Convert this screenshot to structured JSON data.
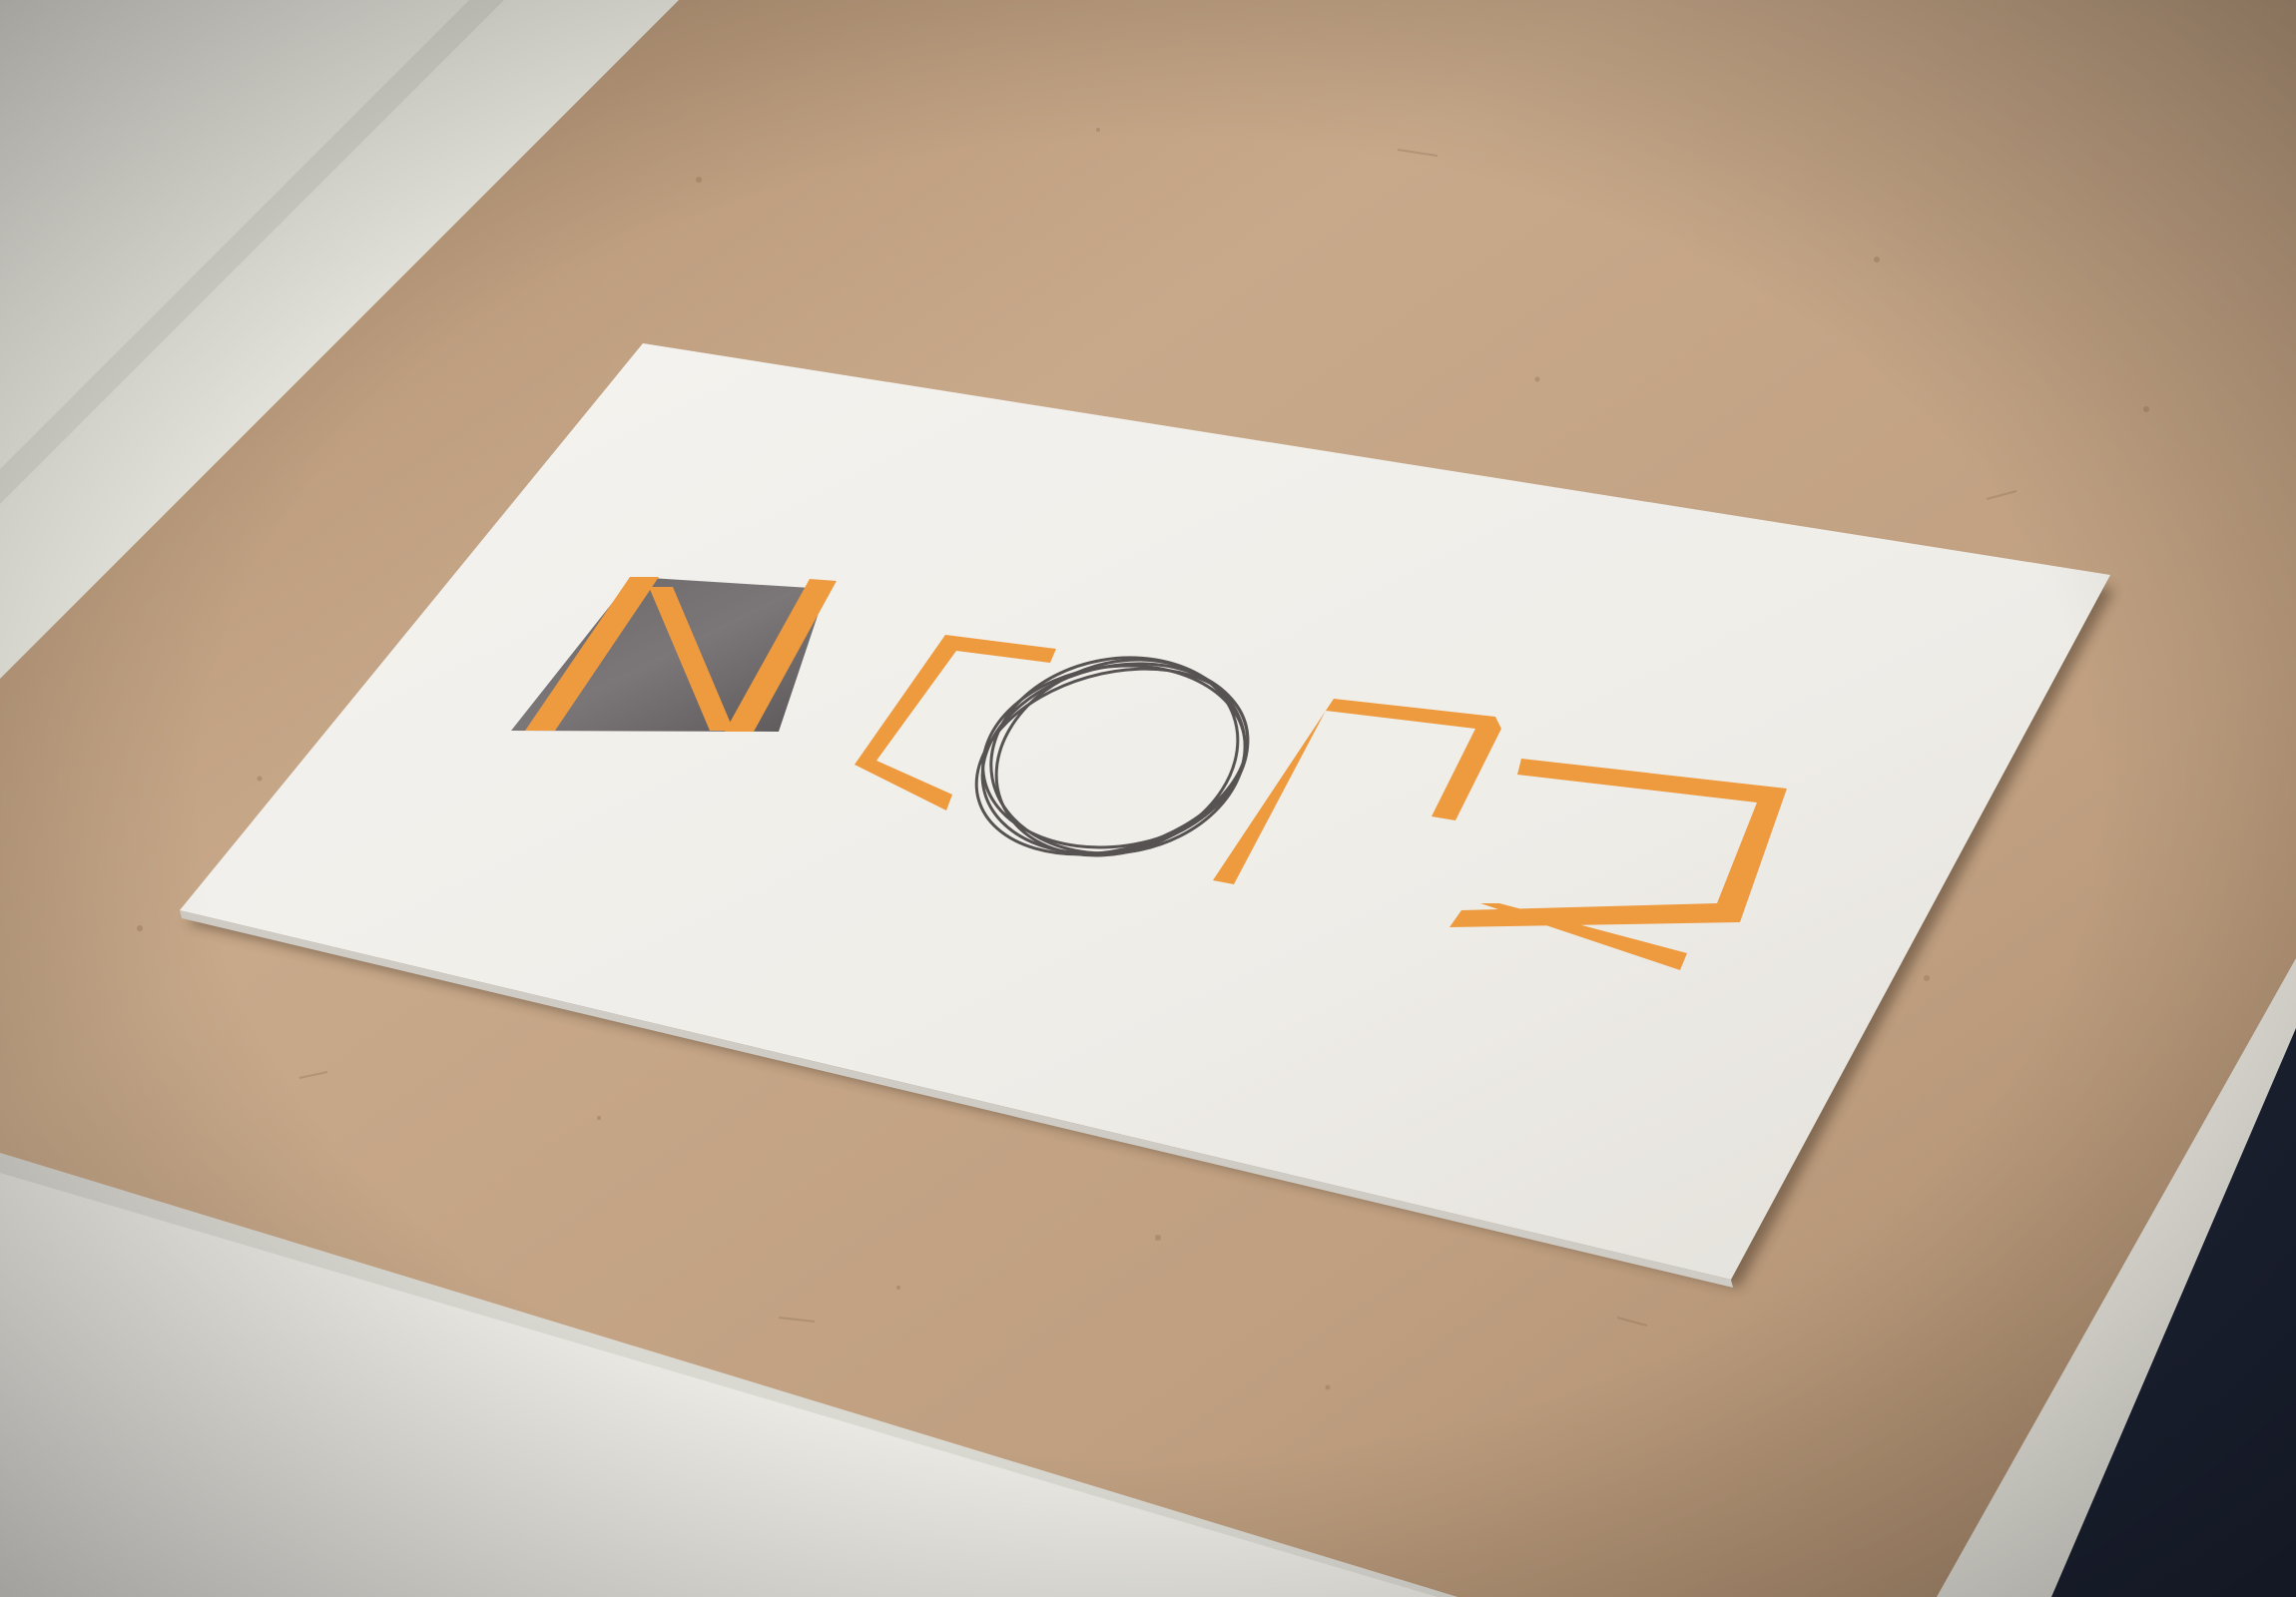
{
  "scene": {
    "subject": "business-card-mockup",
    "surface": "kraft-cardboard"
  },
  "logo": {
    "wordmark": "NCORE",
    "colors": {
      "primary": "#EE9A3F",
      "secondary": "#5F5B5E",
      "ring": "#575353",
      "card": "#F3F2EE",
      "surface": "#B99A7B"
    }
  }
}
